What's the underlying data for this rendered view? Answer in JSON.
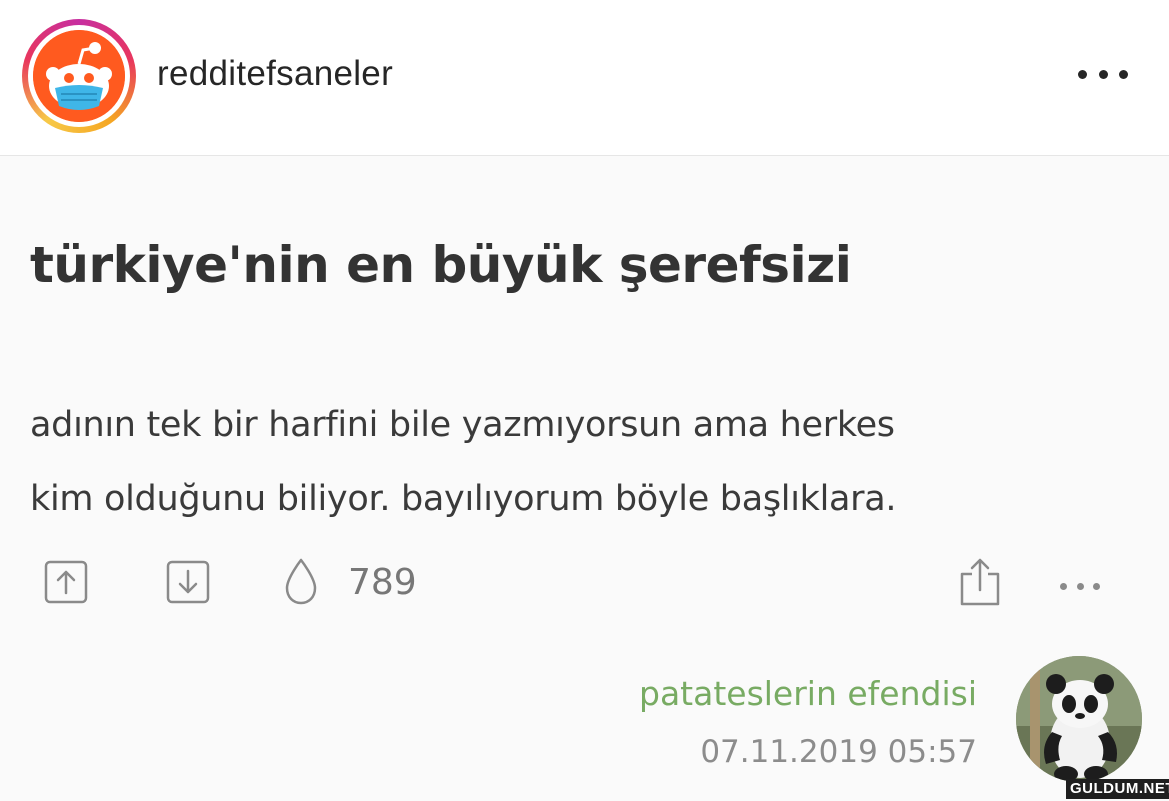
{
  "header": {
    "username": "redditefsaneler",
    "more_icon": "more-horizontal-icon"
  },
  "post": {
    "title": "türkiye'nin en büyük şerefsizi",
    "body_line1": "adının tek bir harfini bile yazmıyorsun ama herkes",
    "body_line2": "kim olduğunu biliyor. bayılıyorum böyle başlıklara.",
    "actions": {
      "upvote_icon": "upvote-icon",
      "downvote_icon": "downvote-icon",
      "drop_icon": "drop-icon",
      "count": "789",
      "share_icon": "share-icon",
      "more_icon": "more-horizontal-icon"
    },
    "author": "patateslerin efendisi",
    "timestamp": "07.11.2019 05:57"
  },
  "watermark": "GULDUM.NET",
  "colors": {
    "author_green": "#78ab63",
    "avatar_orange": "#ff5a1f"
  }
}
